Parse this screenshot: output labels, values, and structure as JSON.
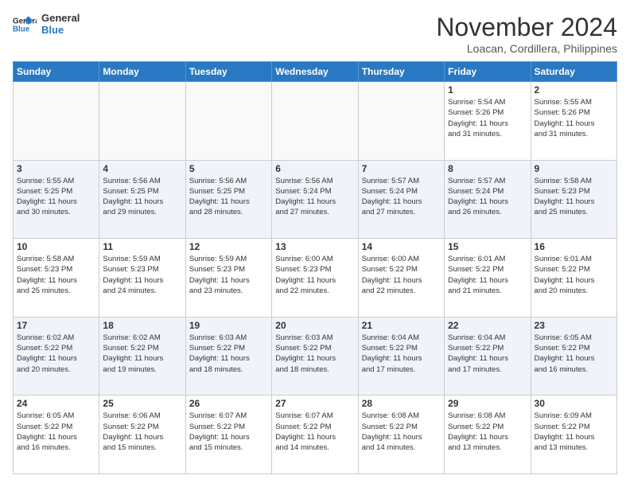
{
  "logo": {
    "line1": "General",
    "line2": "Blue"
  },
  "title": "November 2024",
  "location": "Loacan, Cordillera, Philippines",
  "days_header": [
    "Sunday",
    "Monday",
    "Tuesday",
    "Wednesday",
    "Thursday",
    "Friday",
    "Saturday"
  ],
  "weeks": [
    [
      {
        "day": "",
        "info": ""
      },
      {
        "day": "",
        "info": ""
      },
      {
        "day": "",
        "info": ""
      },
      {
        "day": "",
        "info": ""
      },
      {
        "day": "",
        "info": ""
      },
      {
        "day": "1",
        "info": "Sunrise: 5:54 AM\nSunset: 5:26 PM\nDaylight: 11 hours\nand 31 minutes."
      },
      {
        "day": "2",
        "info": "Sunrise: 5:55 AM\nSunset: 5:26 PM\nDaylight: 11 hours\nand 31 minutes."
      }
    ],
    [
      {
        "day": "3",
        "info": "Sunrise: 5:55 AM\nSunset: 5:25 PM\nDaylight: 11 hours\nand 30 minutes."
      },
      {
        "day": "4",
        "info": "Sunrise: 5:56 AM\nSunset: 5:25 PM\nDaylight: 11 hours\nand 29 minutes."
      },
      {
        "day": "5",
        "info": "Sunrise: 5:56 AM\nSunset: 5:25 PM\nDaylight: 11 hours\nand 28 minutes."
      },
      {
        "day": "6",
        "info": "Sunrise: 5:56 AM\nSunset: 5:24 PM\nDaylight: 11 hours\nand 27 minutes."
      },
      {
        "day": "7",
        "info": "Sunrise: 5:57 AM\nSunset: 5:24 PM\nDaylight: 11 hours\nand 27 minutes."
      },
      {
        "day": "8",
        "info": "Sunrise: 5:57 AM\nSunset: 5:24 PM\nDaylight: 11 hours\nand 26 minutes."
      },
      {
        "day": "9",
        "info": "Sunrise: 5:58 AM\nSunset: 5:23 PM\nDaylight: 11 hours\nand 25 minutes."
      }
    ],
    [
      {
        "day": "10",
        "info": "Sunrise: 5:58 AM\nSunset: 5:23 PM\nDaylight: 11 hours\nand 25 minutes."
      },
      {
        "day": "11",
        "info": "Sunrise: 5:59 AM\nSunset: 5:23 PM\nDaylight: 11 hours\nand 24 minutes."
      },
      {
        "day": "12",
        "info": "Sunrise: 5:59 AM\nSunset: 5:23 PM\nDaylight: 11 hours\nand 23 minutes."
      },
      {
        "day": "13",
        "info": "Sunrise: 6:00 AM\nSunset: 5:23 PM\nDaylight: 11 hours\nand 22 minutes."
      },
      {
        "day": "14",
        "info": "Sunrise: 6:00 AM\nSunset: 5:22 PM\nDaylight: 11 hours\nand 22 minutes."
      },
      {
        "day": "15",
        "info": "Sunrise: 6:01 AM\nSunset: 5:22 PM\nDaylight: 11 hours\nand 21 minutes."
      },
      {
        "day": "16",
        "info": "Sunrise: 6:01 AM\nSunset: 5:22 PM\nDaylight: 11 hours\nand 20 minutes."
      }
    ],
    [
      {
        "day": "17",
        "info": "Sunrise: 6:02 AM\nSunset: 5:22 PM\nDaylight: 11 hours\nand 20 minutes."
      },
      {
        "day": "18",
        "info": "Sunrise: 6:02 AM\nSunset: 5:22 PM\nDaylight: 11 hours\nand 19 minutes."
      },
      {
        "day": "19",
        "info": "Sunrise: 6:03 AM\nSunset: 5:22 PM\nDaylight: 11 hours\nand 18 minutes."
      },
      {
        "day": "20",
        "info": "Sunrise: 6:03 AM\nSunset: 5:22 PM\nDaylight: 11 hours\nand 18 minutes."
      },
      {
        "day": "21",
        "info": "Sunrise: 6:04 AM\nSunset: 5:22 PM\nDaylight: 11 hours\nand 17 minutes."
      },
      {
        "day": "22",
        "info": "Sunrise: 6:04 AM\nSunset: 5:22 PM\nDaylight: 11 hours\nand 17 minutes."
      },
      {
        "day": "23",
        "info": "Sunrise: 6:05 AM\nSunset: 5:22 PM\nDaylight: 11 hours\nand 16 minutes."
      }
    ],
    [
      {
        "day": "24",
        "info": "Sunrise: 6:05 AM\nSunset: 5:22 PM\nDaylight: 11 hours\nand 16 minutes."
      },
      {
        "day": "25",
        "info": "Sunrise: 6:06 AM\nSunset: 5:22 PM\nDaylight: 11 hours\nand 15 minutes."
      },
      {
        "day": "26",
        "info": "Sunrise: 6:07 AM\nSunset: 5:22 PM\nDaylight: 11 hours\nand 15 minutes."
      },
      {
        "day": "27",
        "info": "Sunrise: 6:07 AM\nSunset: 5:22 PM\nDaylight: 11 hours\nand 14 minutes."
      },
      {
        "day": "28",
        "info": "Sunrise: 6:08 AM\nSunset: 5:22 PM\nDaylight: 11 hours\nand 14 minutes."
      },
      {
        "day": "29",
        "info": "Sunrise: 6:08 AM\nSunset: 5:22 PM\nDaylight: 11 hours\nand 13 minutes."
      },
      {
        "day": "30",
        "info": "Sunrise: 6:09 AM\nSunset: 5:22 PM\nDaylight: 11 hours\nand 13 minutes."
      }
    ]
  ]
}
